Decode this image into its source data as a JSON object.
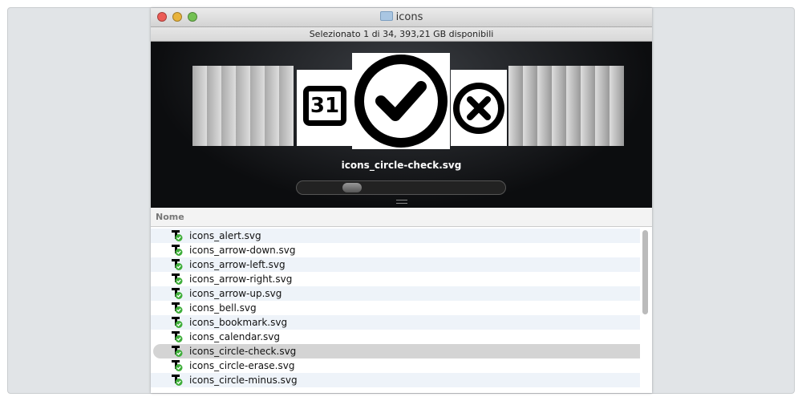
{
  "window": {
    "title": "icons",
    "status": "Selezionato 1 di 34, 393,21 GB disponibili"
  },
  "coverflow": {
    "selected_label": "icons_circle-check.svg",
    "calendar_day": "31",
    "scroll_position": 0.22
  },
  "list": {
    "column_header": "Nome",
    "selected_index": 8,
    "items": [
      "icons_alert.svg",
      "icons_arrow-down.svg",
      "icons_arrow-left.svg",
      "icons_arrow-right.svg",
      "icons_arrow-up.svg",
      "icons_bell.svg",
      "icons_bookmark.svg",
      "icons_calendar.svg",
      "icons_circle-check.svg",
      "icons_circle-erase.svg",
      "icons_circle-minus.svg"
    ]
  },
  "colors": {
    "close": "#ec5b55",
    "minimize": "#e8b33b",
    "zoom": "#73c152",
    "selection": "#d4d4d4"
  }
}
